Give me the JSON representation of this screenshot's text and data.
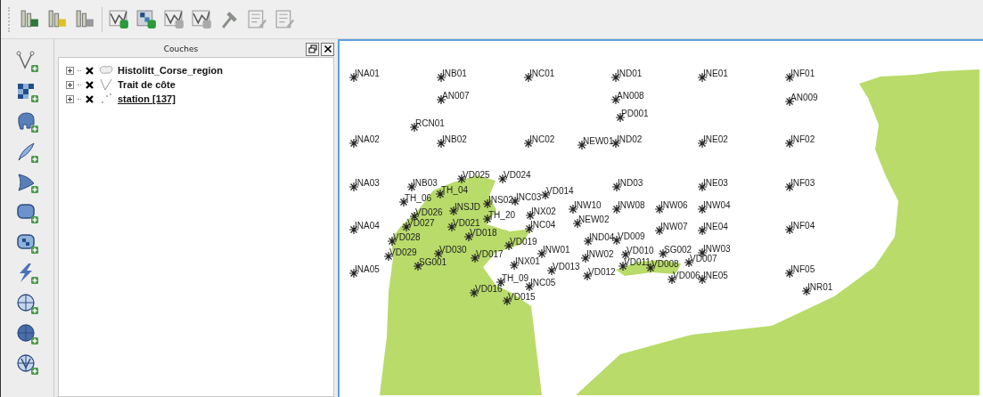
{
  "layers_panel": {
    "title": "Couches",
    "layers": [
      {
        "name": "Histolitt_Corse_region",
        "kind": "polygon",
        "visible": true,
        "expanded": false,
        "selected": false
      },
      {
        "name": "Trait de côte",
        "kind": "line",
        "visible": true,
        "expanded": false,
        "selected": false
      },
      {
        "name": "station [137]",
        "kind": "point",
        "visible": true,
        "expanded": false,
        "selected": true
      }
    ]
  },
  "map": {
    "stations": [
      "INA01",
      "INB01",
      "INC01",
      "IND01",
      "INE01",
      "INF01",
      "AN007",
      "AN008",
      "AN009",
      "PD001",
      "RCN01",
      "INA02",
      "INB02",
      "INC02",
      "NEW01",
      "IND02",
      "INE02",
      "INF02",
      "INA03",
      "INB03",
      "VD025",
      "VD024",
      "TH_06",
      "TH_04",
      "INC03",
      "VD014",
      "IND03",
      "INE03",
      "INF03",
      "INS02",
      "INSJD",
      "INX02",
      "INW10",
      "INW08",
      "INW06",
      "INW04",
      "VD026",
      "TH_20",
      "VD027",
      "VD021",
      "NEW02",
      "INA04",
      "INC04",
      "INW07",
      "INE04",
      "INF04",
      "VD028",
      "VD018",
      "IND04",
      "VD009",
      "VD019",
      "VD029",
      "VD030",
      "VD017",
      "INW01",
      "INW02",
      "VD010",
      "SG002",
      "INW03",
      "SG001",
      "INX01",
      "VD007",
      "INA05",
      "VD013",
      "VD012",
      "VD011",
      "VD008",
      "VD006",
      "INE05",
      "INF05",
      "TH_09",
      "INC05",
      "INR01",
      "VD016",
      "VD015"
    ]
  }
}
